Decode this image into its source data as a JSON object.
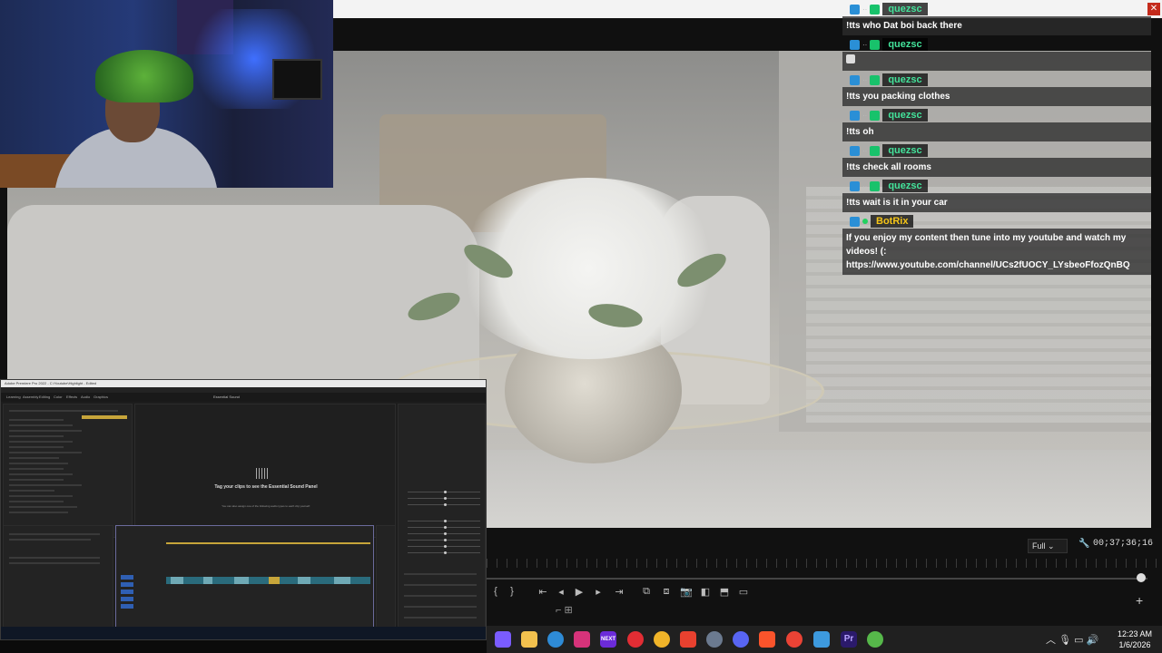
{
  "chat": {
    "messages": [
      {
        "user": "quezsc",
        "text": "!tts who Dat boi back there"
      },
      {
        "user": "quezsc",
        "text": ""
      },
      {
        "user": "quezsc",
        "text": "!tts you packing clothes"
      },
      {
        "user": "quezsc",
        "text": "!tts oh"
      },
      {
        "user": "quezsc",
        "text": "!tts check all rooms"
      },
      {
        "user": "quezsc",
        "text": "!tts wait is it in your car"
      },
      {
        "user": "BotRix",
        "text": "If you enjoy my content then tune into my youtube and watch my videos! (:",
        "text2": "https://www.youtube.com/channel/UCs2fUOCY_LYsbeoFfozQnBQ"
      }
    ]
  },
  "monitor": {
    "fit_label": "Full",
    "timecode": "00;37;36;16",
    "playhead_progress": 0.99
  },
  "premiere": {
    "title": "Adobe Premiere Pro 2022 - C:\\Youtube\\Highlight - Edited",
    "workspace_tabs": [
      "Learning",
      "Assembly",
      "Editing",
      "Color",
      "Effects",
      "Audio",
      "Graphics"
    ],
    "essential_sound_title": "Essential Sound",
    "essential_sound_msg": "Tag your clips to see the Essential Sound Panel",
    "essential_sound_sub": "You can also assign one of the following audio types to each clip yourself:",
    "panel_tabs": [
      "Effect Controls",
      "Essential Sound",
      "Lumetri Color"
    ]
  },
  "taskbar": {
    "time": "12:23 AM",
    "date": "1/6/2026",
    "icons": [
      "copilot-icon",
      "file-explorer-icon",
      "edge-icon",
      "instagram-icon",
      "next-icon",
      "opera-icon",
      "chrome-icon",
      "capcut-icon",
      "settings-icon",
      "discord-icon",
      "brave-icon",
      "chrome-alt-icon",
      "photos-icon",
      "premiere-icon",
      "spotify-icon"
    ],
    "colors": {
      "copilot": "#7a5cff",
      "explorer": "#f2c14e",
      "edge": "#2e8bd6",
      "instagram": "#d6337a",
      "next": "#6b2bd9",
      "opera": "#e22d34",
      "chrome": "#f0b429",
      "capcut": "#e8412f",
      "settings": "#6b7a8f",
      "discord": "#5865f2",
      "brave": "#fb542b",
      "chrome2": "#ea4335",
      "photos": "#3d9ade",
      "premiere": "#2b1a6b",
      "spotify": "#56b84a"
    }
  }
}
